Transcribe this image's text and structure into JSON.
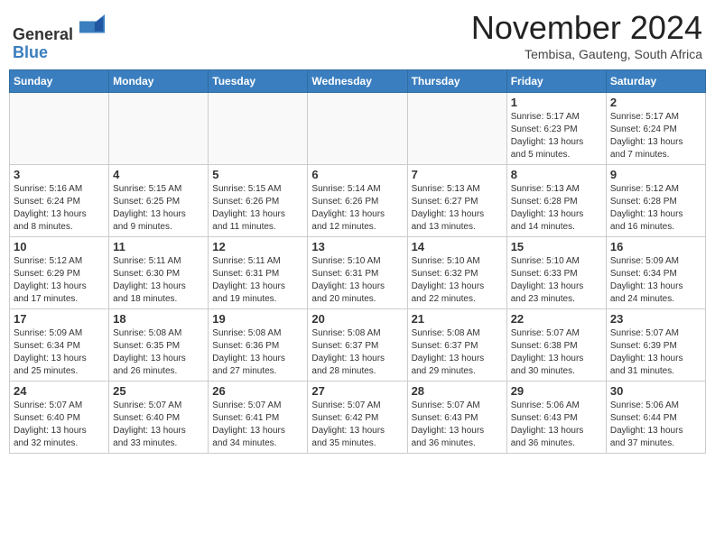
{
  "header": {
    "logo_general": "General",
    "logo_blue": "Blue",
    "month_title": "November 2024",
    "location": "Tembisa, Gauteng, South Africa"
  },
  "weekdays": [
    "Sunday",
    "Monday",
    "Tuesday",
    "Wednesday",
    "Thursday",
    "Friday",
    "Saturday"
  ],
  "weeks": [
    [
      {
        "day": "",
        "info": ""
      },
      {
        "day": "",
        "info": ""
      },
      {
        "day": "",
        "info": ""
      },
      {
        "day": "",
        "info": ""
      },
      {
        "day": "",
        "info": ""
      },
      {
        "day": "1",
        "info": "Sunrise: 5:17 AM\nSunset: 6:23 PM\nDaylight: 13 hours\nand 5 minutes."
      },
      {
        "day": "2",
        "info": "Sunrise: 5:17 AM\nSunset: 6:24 PM\nDaylight: 13 hours\nand 7 minutes."
      }
    ],
    [
      {
        "day": "3",
        "info": "Sunrise: 5:16 AM\nSunset: 6:24 PM\nDaylight: 13 hours\nand 8 minutes."
      },
      {
        "day": "4",
        "info": "Sunrise: 5:15 AM\nSunset: 6:25 PM\nDaylight: 13 hours\nand 9 minutes."
      },
      {
        "day": "5",
        "info": "Sunrise: 5:15 AM\nSunset: 6:26 PM\nDaylight: 13 hours\nand 11 minutes."
      },
      {
        "day": "6",
        "info": "Sunrise: 5:14 AM\nSunset: 6:26 PM\nDaylight: 13 hours\nand 12 minutes."
      },
      {
        "day": "7",
        "info": "Sunrise: 5:13 AM\nSunset: 6:27 PM\nDaylight: 13 hours\nand 13 minutes."
      },
      {
        "day": "8",
        "info": "Sunrise: 5:13 AM\nSunset: 6:28 PM\nDaylight: 13 hours\nand 14 minutes."
      },
      {
        "day": "9",
        "info": "Sunrise: 5:12 AM\nSunset: 6:28 PM\nDaylight: 13 hours\nand 16 minutes."
      }
    ],
    [
      {
        "day": "10",
        "info": "Sunrise: 5:12 AM\nSunset: 6:29 PM\nDaylight: 13 hours\nand 17 minutes."
      },
      {
        "day": "11",
        "info": "Sunrise: 5:11 AM\nSunset: 6:30 PM\nDaylight: 13 hours\nand 18 minutes."
      },
      {
        "day": "12",
        "info": "Sunrise: 5:11 AM\nSunset: 6:31 PM\nDaylight: 13 hours\nand 19 minutes."
      },
      {
        "day": "13",
        "info": "Sunrise: 5:10 AM\nSunset: 6:31 PM\nDaylight: 13 hours\nand 20 minutes."
      },
      {
        "day": "14",
        "info": "Sunrise: 5:10 AM\nSunset: 6:32 PM\nDaylight: 13 hours\nand 22 minutes."
      },
      {
        "day": "15",
        "info": "Sunrise: 5:10 AM\nSunset: 6:33 PM\nDaylight: 13 hours\nand 23 minutes."
      },
      {
        "day": "16",
        "info": "Sunrise: 5:09 AM\nSunset: 6:34 PM\nDaylight: 13 hours\nand 24 minutes."
      }
    ],
    [
      {
        "day": "17",
        "info": "Sunrise: 5:09 AM\nSunset: 6:34 PM\nDaylight: 13 hours\nand 25 minutes."
      },
      {
        "day": "18",
        "info": "Sunrise: 5:08 AM\nSunset: 6:35 PM\nDaylight: 13 hours\nand 26 minutes."
      },
      {
        "day": "19",
        "info": "Sunrise: 5:08 AM\nSunset: 6:36 PM\nDaylight: 13 hours\nand 27 minutes."
      },
      {
        "day": "20",
        "info": "Sunrise: 5:08 AM\nSunset: 6:37 PM\nDaylight: 13 hours\nand 28 minutes."
      },
      {
        "day": "21",
        "info": "Sunrise: 5:08 AM\nSunset: 6:37 PM\nDaylight: 13 hours\nand 29 minutes."
      },
      {
        "day": "22",
        "info": "Sunrise: 5:07 AM\nSunset: 6:38 PM\nDaylight: 13 hours\nand 30 minutes."
      },
      {
        "day": "23",
        "info": "Sunrise: 5:07 AM\nSunset: 6:39 PM\nDaylight: 13 hours\nand 31 minutes."
      }
    ],
    [
      {
        "day": "24",
        "info": "Sunrise: 5:07 AM\nSunset: 6:40 PM\nDaylight: 13 hours\nand 32 minutes."
      },
      {
        "day": "25",
        "info": "Sunrise: 5:07 AM\nSunset: 6:40 PM\nDaylight: 13 hours\nand 33 minutes."
      },
      {
        "day": "26",
        "info": "Sunrise: 5:07 AM\nSunset: 6:41 PM\nDaylight: 13 hours\nand 34 minutes."
      },
      {
        "day": "27",
        "info": "Sunrise: 5:07 AM\nSunset: 6:42 PM\nDaylight: 13 hours\nand 35 minutes."
      },
      {
        "day": "28",
        "info": "Sunrise: 5:07 AM\nSunset: 6:43 PM\nDaylight: 13 hours\nand 36 minutes."
      },
      {
        "day": "29",
        "info": "Sunrise: 5:06 AM\nSunset: 6:43 PM\nDaylight: 13 hours\nand 36 minutes."
      },
      {
        "day": "30",
        "info": "Sunrise: 5:06 AM\nSunset: 6:44 PM\nDaylight: 13 hours\nand 37 minutes."
      }
    ]
  ]
}
